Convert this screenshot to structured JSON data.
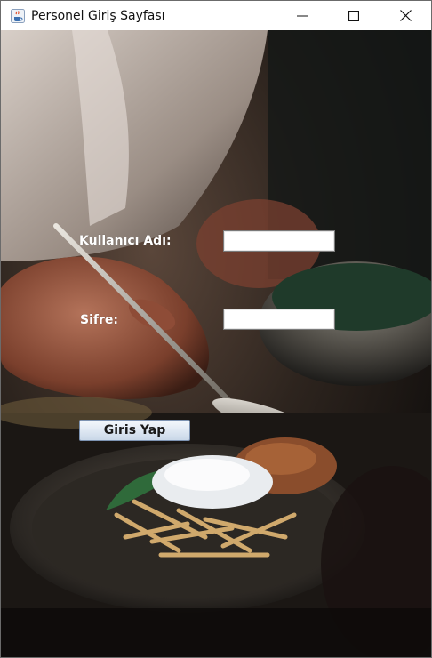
{
  "window": {
    "title": "Personel Giriş Sayfası",
    "icons": {
      "app": "java-cup-icon",
      "minimize": "minimize-icon",
      "maximize": "maximize-icon",
      "close": "close-icon"
    }
  },
  "form": {
    "username_label": "Kullanıcı Adı:",
    "username_value": "",
    "password_label": "Sifre:",
    "password_value": "",
    "submit_label": "Giris Yap"
  },
  "background": {
    "description_icon": "chef-plating-food-photo",
    "colors": {
      "label": "#ffffff",
      "button_border": "#7d93b2"
    }
  }
}
